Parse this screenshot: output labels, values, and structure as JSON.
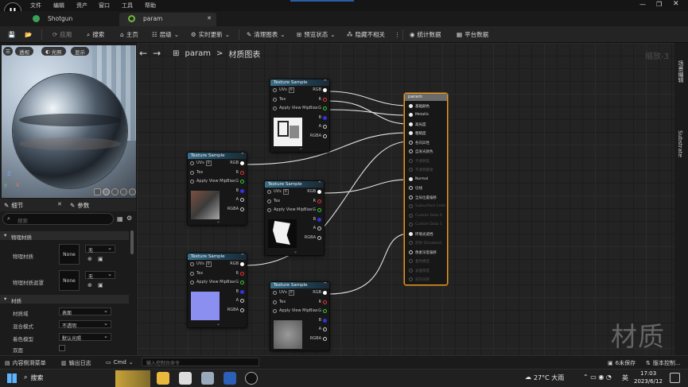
{
  "menubar": {
    "items": [
      "文件",
      "编辑",
      "资产",
      "窗口",
      "工具",
      "帮助"
    ]
  },
  "tabs": [
    {
      "label": "Shotgun"
    },
    {
      "label": "param"
    }
  ],
  "toolbar": {
    "apply": "应用",
    "search": "搜索",
    "home": "主页",
    "hierarchy": "层级",
    "live_update": "实时更新",
    "clean_graph": "清理图表",
    "preview_state": "预览状态",
    "hide_unrelated": "隐藏不相关",
    "stats": "统计数据",
    "platform_stats": "平台数据"
  },
  "viewport": {
    "perspective": "透视",
    "lit": "光照",
    "show": "显示"
  },
  "breadcrumb": {
    "root": "param",
    "sep": ">",
    "child": "材质图表"
  },
  "zoom": "缩放-3",
  "watermark": "材质",
  "details": {
    "tab_details": "细节",
    "tab_params": "参数",
    "search_placeholder": "搜索",
    "section_physical": "物理材质",
    "phys_material": "物理材质",
    "phys_material_mask": "物理材质遮罩",
    "none": "None",
    "none_cn": "无",
    "section_material": "材质",
    "material_domain": "材质域",
    "domain_value": "表面",
    "blend_mode": "混合模式",
    "blend_value": "不透明",
    "shading_model": "着色模型",
    "shading_value": "默认光照",
    "two_sided": "双面"
  },
  "node_common": {
    "title": "Texture Sample",
    "uvs": "UVs",
    "uvs_val": "0",
    "tex": "Tex",
    "mip": "Apply View MipBias",
    "rgb": "RGB",
    "r": "R",
    "g": "G",
    "b": "B",
    "a": "A",
    "rgba": "RGBA"
  },
  "result_node": {
    "title": "param",
    "pins": [
      "基础颜色",
      "Metallic",
      "高光度",
      "粗糙度",
      "各向异性",
      "自发光颜色",
      "不透明度",
      "不透明蒙版",
      "Normal",
      "切线",
      "全局位置偏移",
      "Subsurface Color",
      "Custom Data 0",
      "Custom Data 1",
      "环境光遮挡",
      "折射 (Disabled)",
      "像素深度偏移",
      "着色模型",
      "表面厚度",
      "前向渲染"
    ]
  },
  "right_strip": {
    "level": "场景编辑",
    "substrate": "Substrate"
  },
  "statusbar": {
    "content_drawer": "内容侧滑菜单",
    "output_log": "输出日志",
    "cmd": "Cmd",
    "cmd_placeholder": "输入控制台命令",
    "unsaved": "6未保存",
    "source_control": "版本控制..."
  },
  "taskbar": {
    "search": "搜索",
    "weather": "27°C 大雨",
    "lang": "英",
    "time": "17:03",
    "date": "2023/6/12"
  },
  "colors": {
    "accent_orange": "#e89a27",
    "node_header_blue": "#3b6f8a",
    "graph_bg": "#232323"
  }
}
